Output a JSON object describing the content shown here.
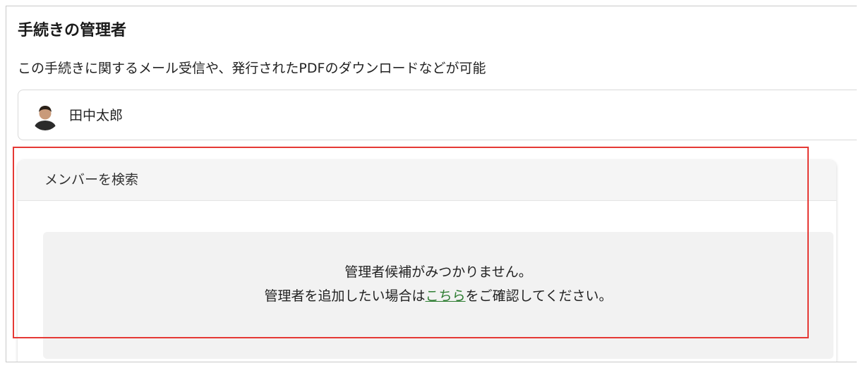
{
  "section": {
    "title": "手続きの管理者",
    "description": "この手続きに関するメール受信や、発行されたPDFのダウンロードなどが可能"
  },
  "manager": {
    "name": "田中太郎",
    "avatar_icon": "user-photo-avatar"
  },
  "search": {
    "header_label": "メンバーを検索",
    "empty_line1": "管理者候補がみつかりません。",
    "empty_line2_prefix": "管理者を追加したい場合は",
    "empty_line2_link": "こちら",
    "empty_line2_suffix": "をご確認してください。"
  },
  "colors": {
    "highlight": "#e53935",
    "link": "#2e7d32",
    "header_bg": "#f5f5f5",
    "empty_bg": "#f2f2f2"
  }
}
